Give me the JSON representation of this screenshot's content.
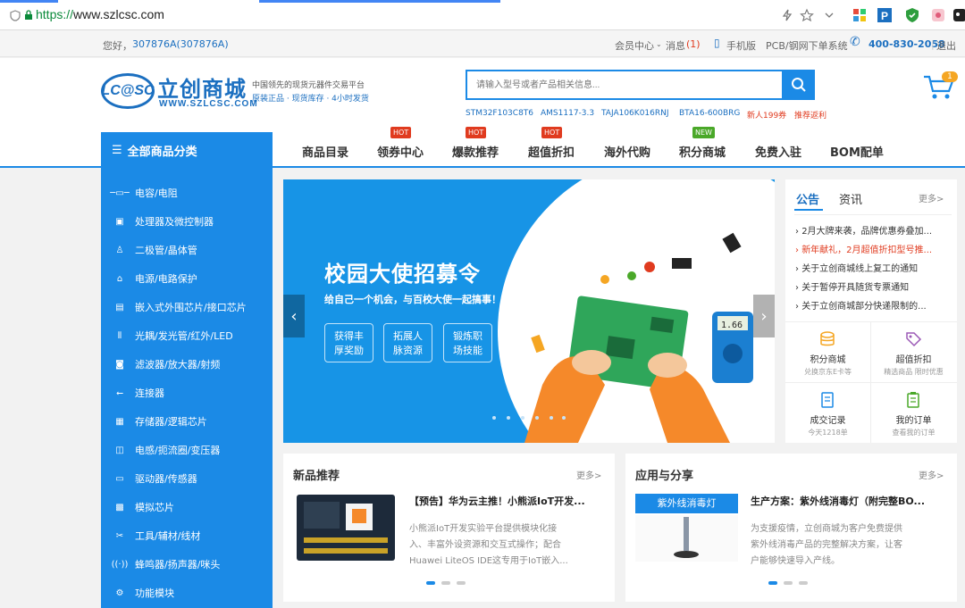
{
  "browser": {
    "url_protocol": "https://",
    "url_host": "www.szlcsc.com"
  },
  "topbar": {
    "greeting": "您好，",
    "user": "307876A(307876A)",
    "member_center": "会员中心",
    "messages": "消息",
    "message_count": "(1)",
    "mobile": "手机版",
    "pcb": "PCB/钢网下单系统",
    "phone": "400-830-2058",
    "logout": "退出"
  },
  "header": {
    "logo_mark": "LC@SC",
    "logo_cn": "立创商城",
    "logo_url": "WWW.SZLCSC.COM",
    "slogan1": "中国领先的现货元器件交易平台",
    "slogan2": "原装正品 · 现货库存 · 4小时发货",
    "search_placeholder": "请输入型号或者产品相关信息...",
    "hot_words": [
      "STM32F103C8T6",
      "AMS1117-3.3",
      "TAJA106K016RNJ",
      "BTA16-600BRG",
      "新人199券",
      "推荐返利"
    ],
    "cart_count": "1"
  },
  "nav": {
    "all_categories": "全部商品分类",
    "items": [
      "商品目录",
      "领券中心",
      "爆款推荐",
      "超值折扣",
      "海外代购",
      "积分商城",
      "免费入驻",
      "BOM配单"
    ],
    "badge_hot": "HOT",
    "badge_new": "NEW"
  },
  "sidebar": {
    "items": [
      {
        "label": "电容/电阻",
        "icon": "resistor-icon"
      },
      {
        "label": "处理器及微控制器",
        "icon": "chip-icon"
      },
      {
        "label": "二极管/晶体管",
        "icon": "diode-icon"
      },
      {
        "label": "电源/电路保护",
        "icon": "power-icon"
      },
      {
        "label": "嵌入式外围芯片/接口芯片",
        "icon": "embedded-icon"
      },
      {
        "label": "光耦/发光管/红外/LED",
        "icon": "optocoupler-icon"
      },
      {
        "label": "滤波器/放大器/射频",
        "icon": "filter-icon"
      },
      {
        "label": "连接器",
        "icon": "usb-icon"
      },
      {
        "label": "存储器/逻辑芯片",
        "icon": "memory-icon"
      },
      {
        "label": "电感/扼流圈/变压器",
        "icon": "inductor-icon"
      },
      {
        "label": "驱动器/传感器",
        "icon": "sensor-icon"
      },
      {
        "label": "模拟芯片",
        "icon": "analog-icon"
      },
      {
        "label": "工具/辅材/线材",
        "icon": "tools-icon"
      },
      {
        "label": "蜂鸣器/扬声器/咪头",
        "icon": "speaker-icon"
      },
      {
        "label": "功能模块",
        "icon": "module-icon"
      }
    ]
  },
  "banner": {
    "title": "校园大使招募令",
    "subtitle": "给自己一个机会，与百校大使一起搞事！",
    "pills": [
      [
        "获得丰",
        "厚奖励"
      ],
      [
        "拓展人",
        "脉资源"
      ],
      [
        "锻炼职",
        "场技能"
      ]
    ],
    "meter_reading": "1.66"
  },
  "notices": {
    "tab_notice": "公告",
    "tab_info": "资讯",
    "more": "更多>",
    "items": [
      "2月大牌来袭，品牌优惠券叠加...",
      "新年献礼，2月超值折扣型号推...",
      "关于立创商城线上复工的通知",
      "关于暂停开具随货专票通知",
      "关于立创商城部分快递限制的..."
    ],
    "grid": [
      {
        "title": "积分商城",
        "sub": "兑换京东E卡等"
      },
      {
        "title": "超值折扣",
        "sub": "精选商品 限时优惠"
      },
      {
        "title": "成交记录",
        "sub": "今天1218单"
      },
      {
        "title": "我的订单",
        "sub": "查看我的订单"
      }
    ]
  },
  "new_products": {
    "title": "新品推荐",
    "more": "更多>",
    "item_title": "【预告】华为云主推！小熊派IoT开发...",
    "item_desc": [
      "小熊派IoT开发实验平台提供模块化接",
      "入、丰富外设资源和交互式操作；配合",
      "Huawei LiteOS IDE这专用于IoT嵌入..."
    ]
  },
  "applications": {
    "title": "应用与分享",
    "more": "更多>",
    "img_label": "紫外线消毒灯",
    "item_title": "生产方案：紫外线消毒灯（附完整BO...",
    "item_desc": [
      "为支援疫情，立创商城为客户免费提供",
      "紫外线消毒产品的完整解决方案，让客",
      "户能够快速导入产线。"
    ]
  },
  "colors": {
    "brand_blue": "#1b8ae6",
    "hot_red": "#e03b1f",
    "new_green": "#4aa829"
  }
}
